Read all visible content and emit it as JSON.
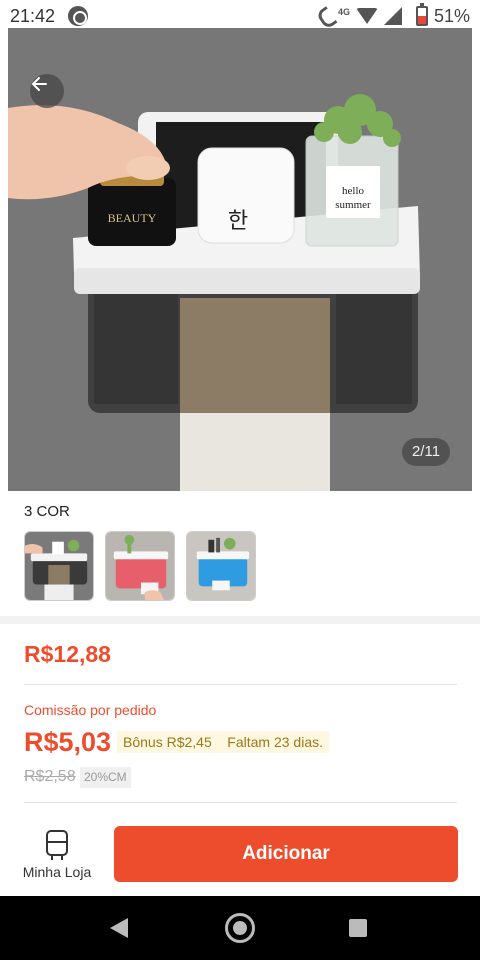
{
  "status_bar": {
    "time": "21:42",
    "network_label": "4G",
    "battery_percent": "51%",
    "icons": [
      "whatsapp-icon",
      "call-icon",
      "wifi-icon",
      "signal-icon",
      "battery-icon"
    ]
  },
  "gallery": {
    "image_counter": "2/11",
    "product_image_text": [
      "BEAUTY",
      "hello",
      "summer"
    ]
  },
  "variants": {
    "label": "3 COR",
    "swatches": [
      {
        "name": "gray",
        "color": "#3a3a3a"
      },
      {
        "name": "pink",
        "color": "#e85f6c"
      },
      {
        "name": "blue",
        "color": "#2f9be0"
      }
    ]
  },
  "pricing": {
    "price": "R$12,88",
    "commission_label": "Comissão por pedido",
    "commission_value": "R$5,03",
    "bonus_text": "Bônus R$2,45    Faltam 23 dias.",
    "old_price": "R$2,58",
    "discount_badge": "20%CM"
  },
  "actions": {
    "store_label": "Minha Loja",
    "add_label": "Adicionar"
  },
  "colors": {
    "accent": "#ee4d2d",
    "bonus_bg": "#fff7e0"
  }
}
